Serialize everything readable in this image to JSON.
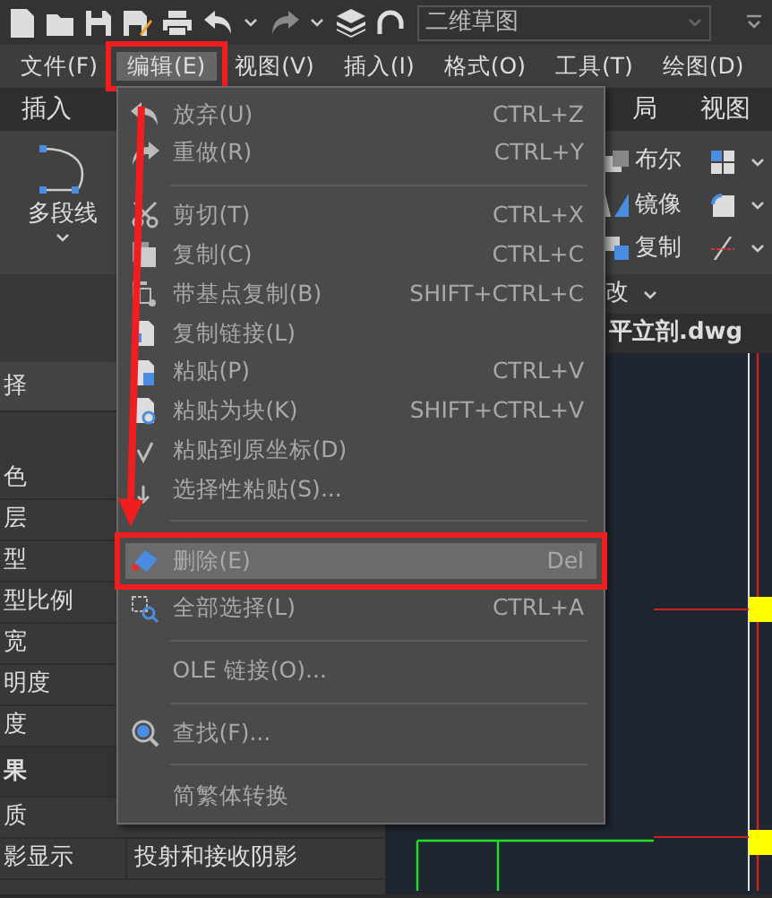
{
  "quick_access_toolbar": {
    "workspace": "二维草图"
  },
  "menu_bar": [
    {
      "label": "文件(F)",
      "selected": false,
      "annotated": false
    },
    {
      "label": "编辑(E)",
      "selected": true,
      "annotated": true
    },
    {
      "label": "视图(V)",
      "selected": false,
      "annotated": false
    },
    {
      "label": "插入(I)",
      "selected": false,
      "annotated": false
    },
    {
      "label": "格式(O)",
      "selected": false,
      "annotated": false
    },
    {
      "label": "工具(T)",
      "selected": false,
      "annotated": false
    },
    {
      "label": "绘图(D)",
      "selected": false,
      "annotated": false
    }
  ],
  "ribbon_tabs": [
    "插入",
    "局",
    "视图"
  ],
  "ribbon": {
    "main_tool": "多段线",
    "tools": [
      "布尔",
      "镜像",
      "复制"
    ],
    "panel_title": "改"
  },
  "document_tab": "平立剖.dwg",
  "properties": {
    "header": "择",
    "rows": [
      {
        "kind": "row",
        "label": "色"
      },
      {
        "kind": "row",
        "label": "层"
      },
      {
        "kind": "row",
        "label": "型"
      },
      {
        "kind": "row",
        "label": "型比例"
      },
      {
        "kind": "row",
        "label": "宽"
      },
      {
        "kind": "row",
        "label": "明度"
      },
      {
        "kind": "row",
        "label": "度"
      },
      {
        "kind": "section",
        "label": "果"
      },
      {
        "kind": "row",
        "label": "质"
      },
      {
        "kind": "row",
        "label": "影显示",
        "value": "投射和接收阴影"
      }
    ]
  },
  "edit_menu": {
    "groups": [
      [
        {
          "label": "放弃(U)",
          "shortcut": "CTRL+Z",
          "selected": false,
          "annotated": false
        },
        {
          "label": "重做(R)",
          "shortcut": "CTRL+Y",
          "selected": false,
          "annotated": false
        }
      ],
      [
        {
          "label": "剪切(T)",
          "shortcut": "CTRL+X",
          "selected": false,
          "annotated": false
        },
        {
          "label": "复制(C)",
          "shortcut": "CTRL+C",
          "selected": false,
          "annotated": false
        },
        {
          "label": "带基点复制(B)",
          "shortcut": "SHIFT+CTRL+C",
          "selected": false,
          "annotated": false
        },
        {
          "label": "复制链接(L)",
          "selected": false,
          "annotated": false
        },
        {
          "label": "粘贴(P)",
          "shortcut": "CTRL+V",
          "selected": false,
          "annotated": false
        },
        {
          "label": "粘贴为块(K)",
          "shortcut": "SHIFT+CTRL+V",
          "selected": false,
          "annotated": false
        },
        {
          "label": "粘贴到原坐标(D)",
          "selected": false,
          "annotated": false
        },
        {
          "label": "选择性粘贴(S)...",
          "selected": false,
          "annotated": false
        }
      ],
      [
        {
          "label": "删除(E)",
          "shortcut": "Del",
          "selected": true,
          "annotated": true
        },
        {
          "label": "全部选择(L)",
          "shortcut": "CTRL+A",
          "selected": false,
          "annotated": false
        }
      ],
      [
        {
          "label": "OLE 链接(O)...",
          "selected": false,
          "annotated": false
        }
      ],
      [
        {
          "label": "查找(F)...",
          "selected": false,
          "annotated": false
        }
      ],
      [
        {
          "label": "简繁体转换",
          "selected": false,
          "annotated": false
        }
      ]
    ]
  },
  "callout_arrow": true
}
